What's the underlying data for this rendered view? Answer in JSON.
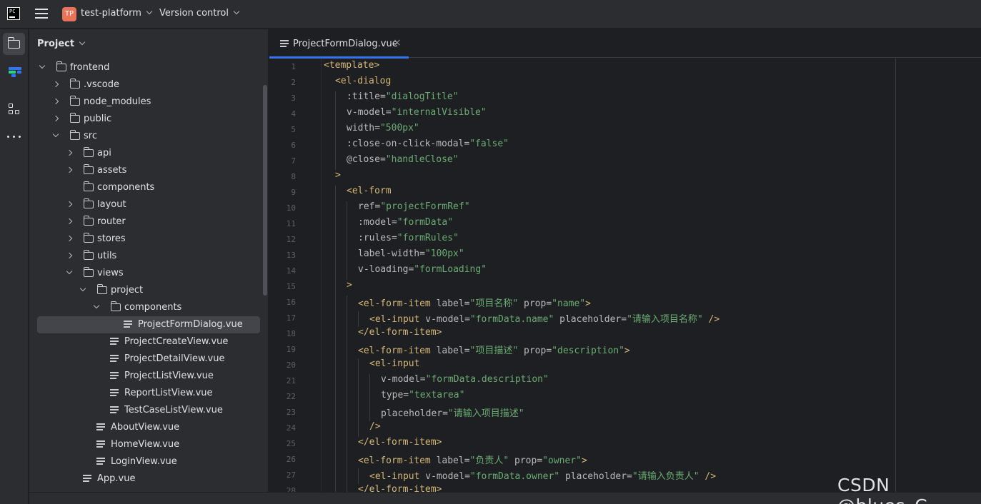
{
  "titlebar": {
    "app_logo_text": "PC",
    "project_badge": "TP",
    "project_name": "test-platform",
    "vcs_menu": "Version control"
  },
  "project_panel": {
    "title": "Project",
    "tree": [
      {
        "label": "frontend",
        "type": "folder",
        "expanded": true,
        "depth": 0
      },
      {
        "label": ".vscode",
        "type": "folder",
        "expanded": false,
        "depth": 1
      },
      {
        "label": "node_modules",
        "type": "folder",
        "expanded": false,
        "depth": 1
      },
      {
        "label": "public",
        "type": "folder",
        "expanded": false,
        "depth": 1
      },
      {
        "label": "src",
        "type": "folder",
        "expanded": true,
        "depth": 1
      },
      {
        "label": "api",
        "type": "folder",
        "expanded": false,
        "depth": 2
      },
      {
        "label": "assets",
        "type": "folder",
        "expanded": false,
        "depth": 2
      },
      {
        "label": "components",
        "type": "folder",
        "expanded": null,
        "depth": 2
      },
      {
        "label": "layout",
        "type": "folder",
        "expanded": false,
        "depth": 2
      },
      {
        "label": "router",
        "type": "folder",
        "expanded": false,
        "depth": 2
      },
      {
        "label": "stores",
        "type": "folder",
        "expanded": false,
        "depth": 2
      },
      {
        "label": "utils",
        "type": "folder",
        "expanded": false,
        "depth": 2
      },
      {
        "label": "views",
        "type": "folder",
        "expanded": true,
        "depth": 2
      },
      {
        "label": "project",
        "type": "folder",
        "expanded": true,
        "depth": 3
      },
      {
        "label": "components",
        "type": "folder",
        "expanded": true,
        "depth": 4
      },
      {
        "label": "ProjectFormDialog.vue",
        "type": "file",
        "depth": 5,
        "selected": true
      },
      {
        "label": "ProjectCreateView.vue",
        "type": "file",
        "depth": 4
      },
      {
        "label": "ProjectDetailView.vue",
        "type": "file",
        "depth": 4
      },
      {
        "label": "ProjectListView.vue",
        "type": "file",
        "depth": 4
      },
      {
        "label": "ReportListView.vue",
        "type": "file",
        "depth": 4
      },
      {
        "label": "TestCaseListView.vue",
        "type": "file",
        "depth": 4
      },
      {
        "label": "AboutView.vue",
        "type": "file",
        "depth": 3
      },
      {
        "label": "HomeView.vue",
        "type": "file",
        "depth": 3
      },
      {
        "label": "LoginView.vue",
        "type": "file",
        "depth": 3
      },
      {
        "label": "App.vue",
        "type": "file",
        "depth": 2
      }
    ]
  },
  "editor": {
    "tab": {
      "label": "ProjectFormDialog.vue",
      "close_glyph": "×"
    },
    "lines": [
      {
        "n": "1",
        "indent": 0,
        "tokens": [
          [
            "tag",
            "<template>"
          ]
        ]
      },
      {
        "n": "2",
        "indent": 1,
        "tokens": [
          [
            "tag",
            "<el-dialog"
          ]
        ]
      },
      {
        "n": "3",
        "indent": 2,
        "tokens": [
          [
            "attr",
            ":title="
          ],
          [
            "str",
            "\"dialogTitle\""
          ]
        ]
      },
      {
        "n": "4",
        "indent": 2,
        "tokens": [
          [
            "attr",
            "v-model="
          ],
          [
            "str",
            "\"internalVisible\""
          ]
        ]
      },
      {
        "n": "5",
        "indent": 2,
        "tokens": [
          [
            "attr",
            "width="
          ],
          [
            "str",
            "\"500px\""
          ]
        ]
      },
      {
        "n": "6",
        "indent": 2,
        "tokens": [
          [
            "attr",
            ":close-on-click-modal="
          ],
          [
            "str",
            "\"false\""
          ]
        ]
      },
      {
        "n": "7",
        "indent": 2,
        "tokens": [
          [
            "attr",
            "@close="
          ],
          [
            "str",
            "\"handleClose\""
          ]
        ]
      },
      {
        "n": "8",
        "indent": 1,
        "tokens": [
          [
            "tag",
            ">"
          ]
        ]
      },
      {
        "n": "9",
        "indent": 2,
        "tokens": [
          [
            "tag",
            "<el-form"
          ]
        ]
      },
      {
        "n": "10",
        "indent": 3,
        "tokens": [
          [
            "attr",
            "ref="
          ],
          [
            "str",
            "\"projectFormRef\""
          ]
        ]
      },
      {
        "n": "11",
        "indent": 3,
        "tokens": [
          [
            "attr",
            ":model="
          ],
          [
            "str",
            "\"formData\""
          ]
        ]
      },
      {
        "n": "12",
        "indent": 3,
        "tokens": [
          [
            "attr",
            ":rules="
          ],
          [
            "str",
            "\"formRules\""
          ]
        ]
      },
      {
        "n": "13",
        "indent": 3,
        "tokens": [
          [
            "attr",
            "label-width="
          ],
          [
            "str",
            "\"100px\""
          ]
        ]
      },
      {
        "n": "14",
        "indent": 3,
        "tokens": [
          [
            "attr",
            "v-loading="
          ],
          [
            "str",
            "\"formLoading\""
          ]
        ]
      },
      {
        "n": "15",
        "indent": 2,
        "tokens": [
          [
            "tag",
            ">"
          ]
        ]
      },
      {
        "n": "16",
        "indent": 3,
        "tokens": [
          [
            "tag",
            "<el-form-item "
          ],
          [
            "attr",
            "label="
          ],
          [
            "str",
            "\"项目名称\""
          ],
          [
            "plain",
            " "
          ],
          [
            "attr",
            "prop="
          ],
          [
            "str",
            "\"name\""
          ],
          [
            "tag",
            ">"
          ]
        ]
      },
      {
        "n": "17",
        "indent": 4,
        "tokens": [
          [
            "tag",
            "<el-input "
          ],
          [
            "attr",
            "v-model="
          ],
          [
            "str",
            "\"formData.name\""
          ],
          [
            "plain",
            " "
          ],
          [
            "attr",
            "placeholder="
          ],
          [
            "str",
            "\"请输入项目名称\""
          ],
          [
            "tag",
            " />"
          ]
        ]
      },
      {
        "n": "18",
        "indent": 3,
        "tokens": [
          [
            "tag",
            "</el-form-item>"
          ]
        ]
      },
      {
        "n": "19",
        "indent": 3,
        "tokens": [
          [
            "tag",
            "<el-form-item "
          ],
          [
            "attr",
            "label="
          ],
          [
            "str",
            "\"项目描述\""
          ],
          [
            "plain",
            " "
          ],
          [
            "attr",
            "prop="
          ],
          [
            "str",
            "\"description\""
          ],
          [
            "tag",
            ">"
          ]
        ]
      },
      {
        "n": "20",
        "indent": 4,
        "tokens": [
          [
            "tag",
            "<el-input"
          ]
        ]
      },
      {
        "n": "21",
        "indent": 5,
        "tokens": [
          [
            "attr",
            "v-model="
          ],
          [
            "str",
            "\"formData.description\""
          ]
        ]
      },
      {
        "n": "22",
        "indent": 5,
        "tokens": [
          [
            "attr",
            "type="
          ],
          [
            "str",
            "\"textarea\""
          ]
        ]
      },
      {
        "n": "23",
        "indent": 5,
        "tokens": [
          [
            "attr",
            "placeholder="
          ],
          [
            "str",
            "\"请输入项目描述\""
          ]
        ]
      },
      {
        "n": "24",
        "indent": 4,
        "tokens": [
          [
            "tag",
            "/>"
          ]
        ]
      },
      {
        "n": "25",
        "indent": 3,
        "tokens": [
          [
            "tag",
            "</el-form-item>"
          ]
        ]
      },
      {
        "n": "26",
        "indent": 3,
        "tokens": [
          [
            "tag",
            "<el-form-item "
          ],
          [
            "attr",
            "label="
          ],
          [
            "str",
            "\"负责人\""
          ],
          [
            "plain",
            " "
          ],
          [
            "attr",
            "prop="
          ],
          [
            "str",
            "\"owner\""
          ],
          [
            "tag",
            ">"
          ]
        ]
      },
      {
        "n": "27",
        "indent": 4,
        "tokens": [
          [
            "tag",
            "<el-input "
          ],
          [
            "attr",
            "v-model="
          ],
          [
            "str",
            "\"formData.owner\""
          ],
          [
            "plain",
            " "
          ],
          [
            "attr",
            "placeholder="
          ],
          [
            "str",
            "\"请输入负责人\""
          ],
          [
            "tag",
            " />"
          ]
        ]
      },
      {
        "n": "28",
        "indent": 3,
        "tokens": [
          [
            "tag",
            "</el-form-item>"
          ]
        ]
      }
    ]
  },
  "watermark": "CSDN @blues_C",
  "colors": {
    "accent": "#3574f0",
    "tag": "#d5b778",
    "attr": "#bababa",
    "string": "#6aab73",
    "badge": "#e8735a"
  }
}
